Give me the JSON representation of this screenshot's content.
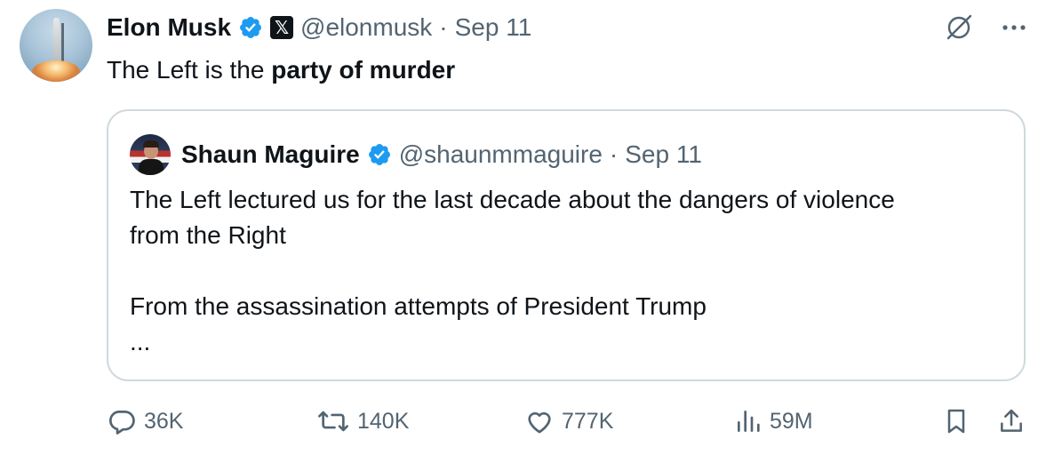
{
  "author": {
    "name": "Elon Musk",
    "handle": "@elonmusk",
    "separator": "·",
    "date": "Sep 11",
    "affiliate_badge": "𝕏"
  },
  "tweet": {
    "text_plain": "The Left is the ",
    "text_bold": "party of murder"
  },
  "quoted": {
    "name": "Shaun Maguire",
    "handle": "@shaunmmaguire",
    "separator": "·",
    "date": "Sep 11",
    "text": "The Left lectured us for the last decade about the dangers of violence\nfrom the Right\n\nFrom the assassination attempts of President Trump\n..."
  },
  "actions": {
    "replies": "36K",
    "reposts": "140K",
    "likes": "777K",
    "views": "59M"
  },
  "icons": [
    "grok-icon",
    "more-icon",
    "reply-icon",
    "repost-icon",
    "like-icon",
    "views-icon",
    "bookmark-icon",
    "share-icon",
    "verified-badge-icon"
  ],
  "colors": {
    "verified_blue": "#1d9bf0",
    "muted": "#536471",
    "text": "#0f1419",
    "border": "#cfd9de"
  }
}
